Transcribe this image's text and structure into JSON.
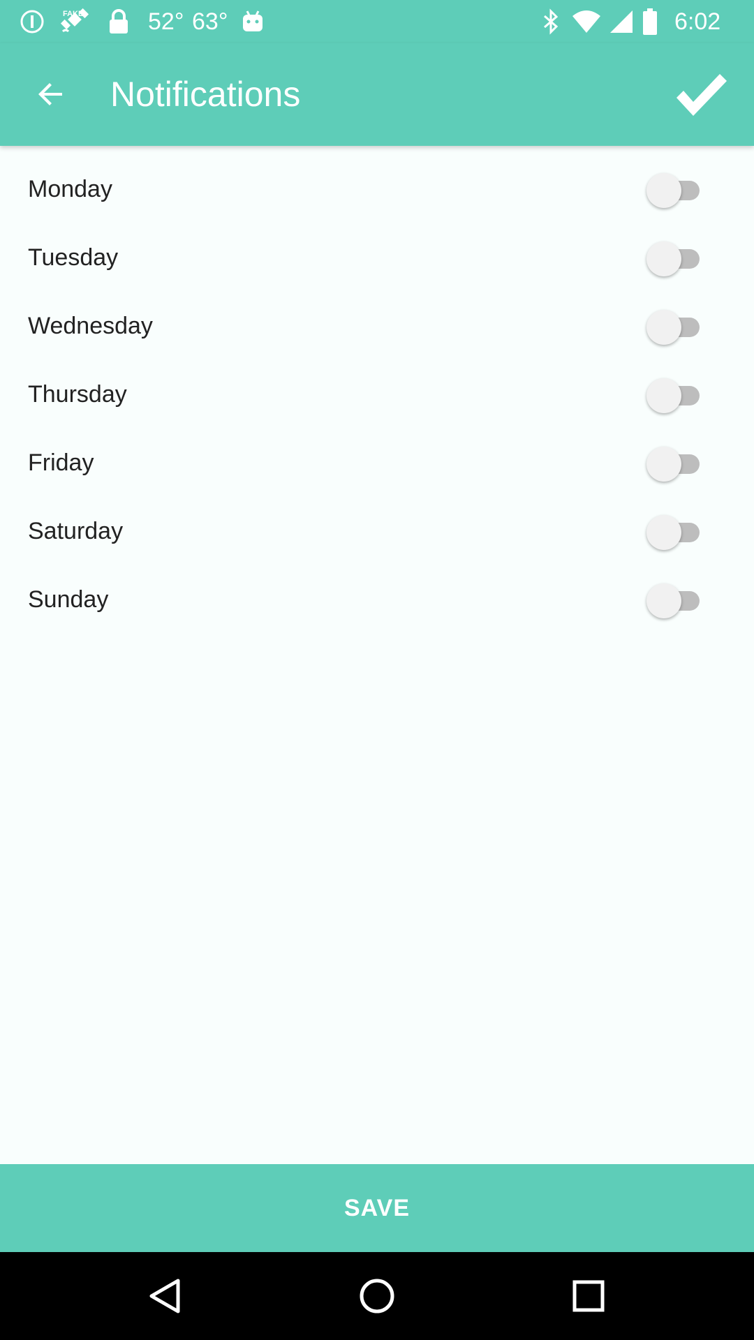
{
  "status_bar": {
    "temp_1": "52°",
    "temp_2": "63°",
    "time": "6:02",
    "icons": [
      "alert-circle-icon",
      "satellite-icon",
      "lock-icon",
      "android-icon",
      "bluetooth-icon",
      "wifi-icon",
      "signal-icon",
      "battery-icon"
    ]
  },
  "app_bar": {
    "title": "Notifications",
    "back_icon": "arrow-back-icon",
    "confirm_icon": "check-icon"
  },
  "days": [
    {
      "label": "Monday",
      "enabled": false
    },
    {
      "label": "Tuesday",
      "enabled": false
    },
    {
      "label": "Wednesday",
      "enabled": false
    },
    {
      "label": "Thursday",
      "enabled": false
    },
    {
      "label": "Friday",
      "enabled": false
    },
    {
      "label": "Saturday",
      "enabled": false
    },
    {
      "label": "Sunday",
      "enabled": false
    }
  ],
  "save_button": {
    "label": "SAVE"
  },
  "nav_bar": {
    "icons": [
      "back-triangle-icon",
      "home-circle-icon",
      "recents-square-icon"
    ]
  },
  "colors": {
    "accent": "#5ecdb8",
    "background": "#f9fefd",
    "switch_track_off": "#bdbdbd",
    "switch_thumb_off": "#f1f1f1"
  }
}
